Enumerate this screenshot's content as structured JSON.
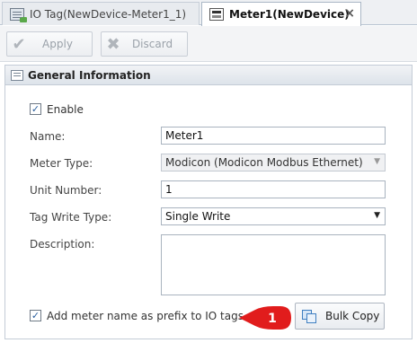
{
  "tabs": [
    {
      "label": "IO Tag(NewDevice-Meter1_1)",
      "icon": "io-tag-icon",
      "active": false
    },
    {
      "label": "Meter1(NewDevice)",
      "icon": "meter-icon",
      "active": true,
      "close": "×"
    }
  ],
  "toolbar": {
    "apply_label": "Apply",
    "discard_label": "Discard"
  },
  "panel": {
    "title": "General Information"
  },
  "form": {
    "enable_label": "Enable",
    "name_label": "Name:",
    "name_value": "Meter1",
    "meter_type_label": "Meter Type:",
    "meter_type_value": "Modicon (Modicon Modbus Ethernet)",
    "unit_number_label": "Unit Number:",
    "unit_number_value": "1",
    "tag_write_type_label": "Tag Write Type:",
    "tag_write_type_value": "Single Write",
    "description_label": "Description:",
    "description_value": "",
    "prefix_label": "Add meter name as prefix to IO tags",
    "bulk_copy_label": "Bulk Copy"
  },
  "callout": {
    "number": "1",
    "color": "#e11c1c"
  },
  "colors": {
    "accent": "#2a5f9e",
    "callout": "#e11c1c"
  }
}
